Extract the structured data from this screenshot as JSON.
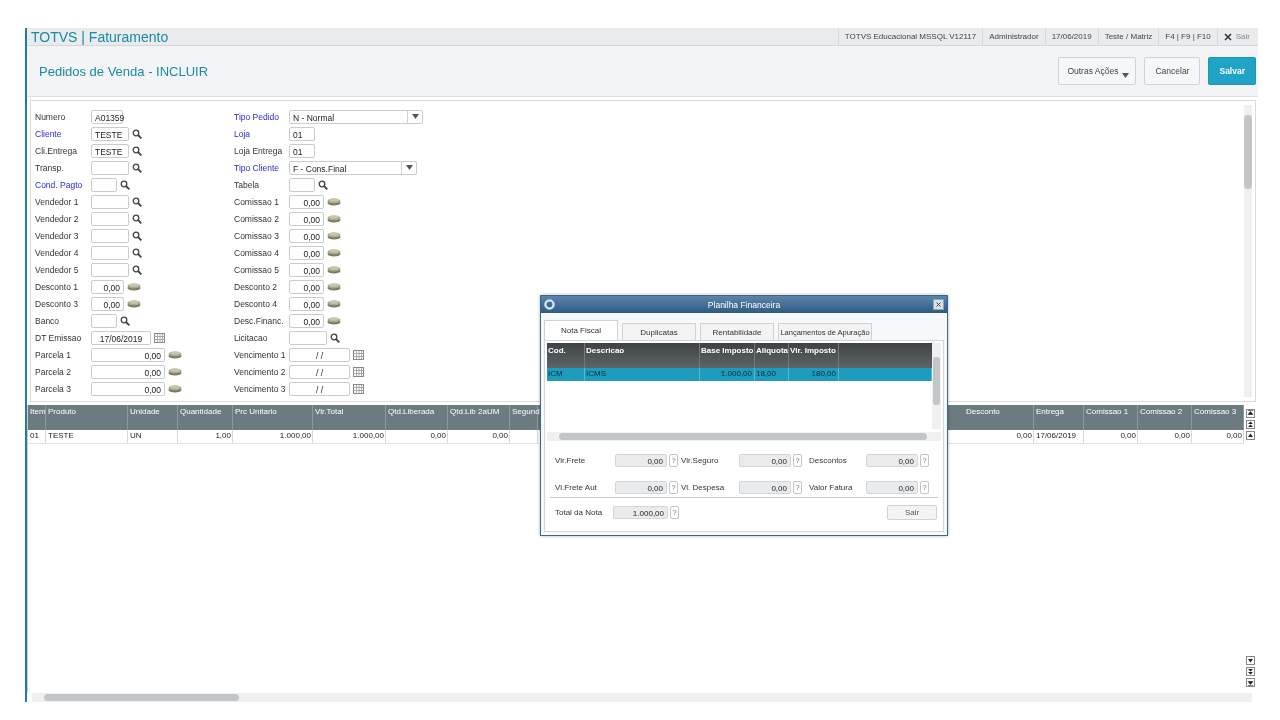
{
  "top_bar": {
    "title": "TOTVS | Faturamento",
    "items": [
      "TOTVS Educacional MSSQL V12117",
      "Administrador",
      "17/06/2019",
      "Teste / Matriz",
      "F4 | F9 | F10"
    ],
    "exit_label": "Sair"
  },
  "page": {
    "title": "Pedidos de Venda - INCLUIR",
    "buttons": [
      {
        "label": "Outras Ações",
        "kind": "menu"
      },
      {
        "label": "Cancelar",
        "kind": "default"
      },
      {
        "label": "Salvar",
        "kind": "primary"
      }
    ]
  },
  "form": {
    "left_fields": [
      {
        "label": "Numero",
        "required": false,
        "kind": "text",
        "value": "A01359"
      },
      {
        "label": "Cliente",
        "required": true,
        "kind": "lookup",
        "value": "TESTE"
      },
      {
        "label": "Cli.Entrega",
        "required": false,
        "kind": "lookup",
        "value": "TESTE"
      },
      {
        "label": "Transp.",
        "required": false,
        "kind": "lookup"
      },
      {
        "label": "Cond. Pagto",
        "required": true,
        "kind": "lookup"
      },
      {
        "label": "Vendedor 1",
        "required": false,
        "kind": "lookup"
      },
      {
        "label": "Vendedor 2",
        "required": false,
        "kind": "lookup"
      },
      {
        "label": "Vendedor 3",
        "required": false,
        "kind": "lookup"
      },
      {
        "label": "Vendedor 4",
        "required": false,
        "kind": "lookup"
      },
      {
        "label": "Vendedor 5",
        "required": false,
        "kind": "lookup"
      },
      {
        "label": "Desconto 1",
        "required": false,
        "kind": "money",
        "value": "0,00"
      },
      {
        "label": "Desconto 3",
        "required": false,
        "kind": "money",
        "value": "0,00"
      },
      {
        "label": "Banco",
        "required": false,
        "kind": "lookup"
      },
      {
        "label": "DT Emissao",
        "required": false,
        "kind": "date",
        "value": "17/06/2019"
      },
      {
        "label": "Parcela 1",
        "required": false,
        "kind": "money",
        "value": "0,00"
      },
      {
        "label": "Parcela 2",
        "required": false,
        "kind": "money",
        "value": "0,00"
      },
      {
        "label": "Parcela 3",
        "required": false,
        "kind": "money",
        "value": "0,00"
      }
    ],
    "right_fields": [
      {
        "label": "Tipo Pedido",
        "required": true,
        "kind": "combo",
        "value": "N - Normal"
      },
      {
        "label": "Loja",
        "required": true,
        "kind": "text",
        "value": "01"
      },
      {
        "label": "Loja Entrega",
        "required": false,
        "kind": "text",
        "value": "01"
      },
      {
        "label": "Tipo Cliente",
        "required": true,
        "kind": "combo",
        "value": "F - Cons.Final"
      },
      {
        "label": "Tabela",
        "required": false,
        "kind": "lookup"
      },
      {
        "label": "Comissao 1",
        "required": false,
        "kind": "money",
        "value": "0,00"
      },
      {
        "label": "Comissao 2",
        "required": false,
        "kind": "money",
        "value": "0,00"
      },
      {
        "label": "Comissao 3",
        "required": false,
        "kind": "money",
        "value": "0,00"
      },
      {
        "label": "Comissao 4",
        "required": false,
        "kind": "money",
        "value": "0,00"
      },
      {
        "label": "Comissao 5",
        "required": false,
        "kind": "money",
        "value": "0,00"
      },
      {
        "label": "Desconto 2",
        "required": false,
        "kind": "money",
        "value": "0,00"
      },
      {
        "label": "Desconto 4",
        "required": false,
        "kind": "money",
        "value": "0,00"
      },
      {
        "label": "Desc.Financ.",
        "required": false,
        "kind": "money",
        "value": "0,00"
      },
      {
        "label": "Licitacao",
        "required": false,
        "kind": "lookup"
      },
      {
        "label": "Vencimento 1",
        "required": false,
        "kind": "date",
        "value": " / /"
      },
      {
        "label": "Vencimento 2",
        "required": false,
        "kind": "date",
        "value": " / /"
      },
      {
        "label": "Vencimento 3",
        "required": false,
        "kind": "date",
        "value": " / /"
      }
    ]
  },
  "items_grid": {
    "left_columns": [
      {
        "label": "Item",
        "kind": "text"
      },
      {
        "label": "Produto",
        "kind": "text"
      },
      {
        "label": "Unidade",
        "kind": "text"
      },
      {
        "label": "Quantidade",
        "kind": "number"
      },
      {
        "label": "Prc Unitario",
        "kind": "number"
      },
      {
        "label": "Vlr.Total",
        "kind": "number"
      },
      {
        "label": "Qtd.Liberada",
        "kind": "number"
      },
      {
        "label": "Qtd.Lib 2aUM",
        "kind": "number"
      },
      {
        "label": "Segund",
        "kind": "text"
      }
    ],
    "right_columns": [
      {
        "label": "Desconto",
        "kind": "number"
      },
      {
        "label": "Entrega",
        "kind": "text"
      },
      {
        "label": "Comissao 1",
        "kind": "number"
      },
      {
        "label": "Comissao 2",
        "kind": "number"
      },
      {
        "label": "Comissao 3",
        "kind": "number"
      }
    ],
    "rows": [
      {
        "left_cells": [
          "01",
          "TESTE",
          "UN",
          "1,00",
          "1.000,00",
          "1.000,00",
          "0,00",
          "0,00"
        ],
        "right_cells": [
          "0,00",
          "17/06/2019",
          "0,00",
          "0,00",
          "0,00"
        ]
      }
    ]
  },
  "dialog": {
    "title": "Planilha Financeira",
    "tabs": [
      {
        "label": "Nota Fiscal",
        "selected": true
      },
      {
        "label": "Duplicatas",
        "selected": false
      },
      {
        "label": "Rentabilidade",
        "selected": false
      },
      {
        "label": "Lançamentos de Apuração",
        "selected": false
      }
    ],
    "table": {
      "columns": [
        {
          "label": "Cod.",
          "kind": "text"
        },
        {
          "label": "Descricao",
          "kind": "text"
        },
        {
          "label": "Base Imposto",
          "kind": "number"
        },
        {
          "label": "Aliquota",
          "kind": "text"
        },
        {
          "label": "Vlr. Imposto",
          "kind": "number"
        }
      ],
      "rows": [
        {
          "cells": [
            "ICM",
            "ICMS",
            "1.000,00",
            "18,00",
            "180,00"
          ],
          "selected": true
        }
      ]
    },
    "fields": [
      {
        "label": "Vlr.Frete",
        "value": "0,00",
        "help": "?"
      },
      {
        "label": "Vlr.Seguro",
        "value": "0,00",
        "help": "?"
      },
      {
        "label": "Descontos",
        "value": "0,00",
        "help": "?"
      },
      {
        "label": "Vl.Frete Aut",
        "value": "0,00",
        "help": "?"
      },
      {
        "label": "Vl. Despesa",
        "value": "0,00",
        "help": "?"
      },
      {
        "label": "Valor Fatura",
        "value": "0,00",
        "help": "?"
      }
    ],
    "total": {
      "label": "Total da Nota",
      "value": "1.000,00",
      "help": "?"
    },
    "close_button": "Sair"
  }
}
